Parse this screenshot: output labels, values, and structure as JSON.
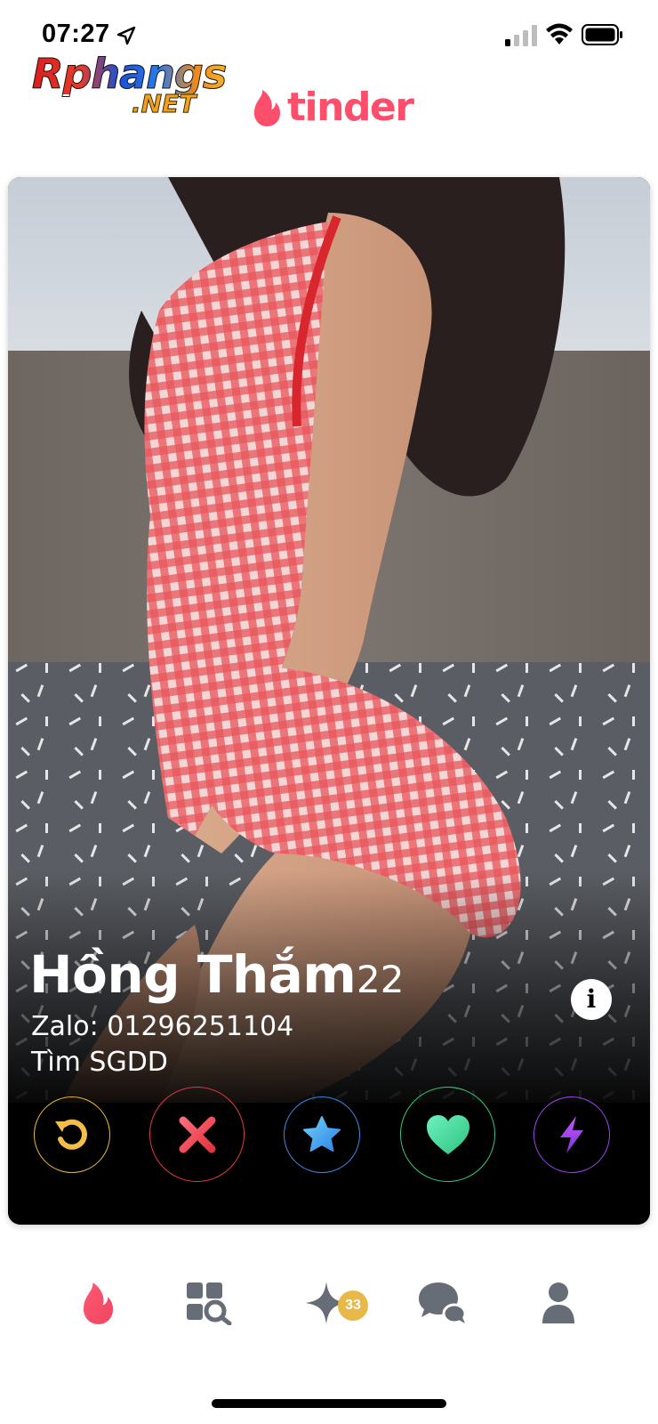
{
  "status_bar": {
    "time": "07:27",
    "icons": [
      "location-arrow-icon",
      "cellular-signal-icon",
      "wifi-icon",
      "battery-icon"
    ]
  },
  "watermark": {
    "line1": "Rphangs",
    "line2": ".NET"
  },
  "header": {
    "brand_text": "tinder",
    "brand_icon": "flame-icon",
    "brand_color": "#fd4e6c"
  },
  "profile": {
    "name": "Hồng Thắm",
    "age": "22",
    "bio_line1": "Zalo: 01296251104",
    "bio_line2": "Tìm SGDD",
    "info_label": "i"
  },
  "actions": [
    {
      "name": "rewind",
      "icon": "rewind-icon",
      "color": "#e8b93a"
    },
    {
      "name": "nope",
      "icon": "close-icon",
      "color": "#e03a45"
    },
    {
      "name": "super-like",
      "icon": "star-icon",
      "color": "#3a8ae0"
    },
    {
      "name": "like",
      "icon": "heart-icon",
      "color": "#35c97a"
    },
    {
      "name": "boost",
      "icon": "lightning-icon",
      "color": "#9a45e8"
    }
  ],
  "tabbar": {
    "tabs": [
      {
        "name": "home",
        "icon": "flame-icon",
        "active": true
      },
      {
        "name": "explore",
        "icon": "explore-icon",
        "active": false
      },
      {
        "name": "gold",
        "icon": "sparkle-icon",
        "active": false
      },
      {
        "name": "messages",
        "icon": "chat-icon",
        "active": false
      },
      {
        "name": "profile",
        "icon": "person-icon",
        "active": false
      }
    ],
    "gold_badge_count": "33"
  }
}
